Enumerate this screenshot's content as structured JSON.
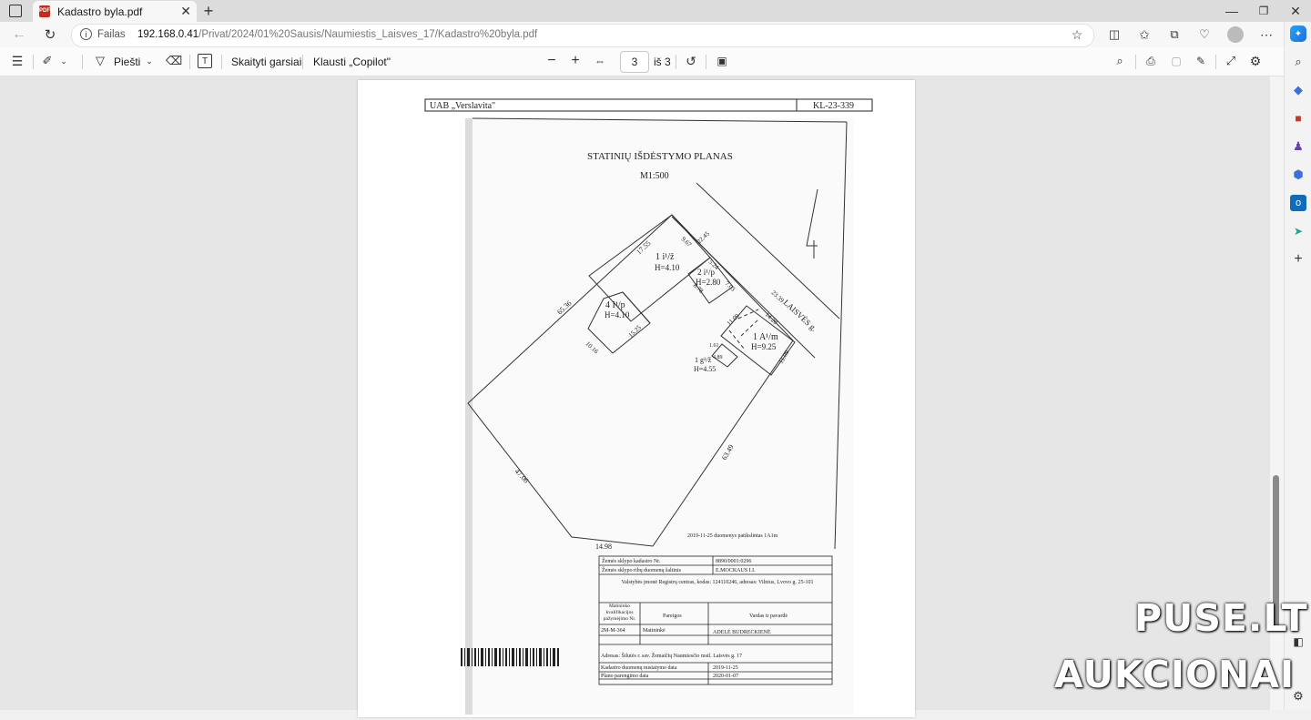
{
  "tab": {
    "title": "Kadastro byla.pdf",
    "icon": "pdf-file-icon"
  },
  "address": {
    "label": "Failas",
    "host": "192.168.0.41",
    "path": "/Privat/2024/01%20Sausis/Naumiestis_Laisves_17/Kadastro%20byla.pdf"
  },
  "pdf_toolbar": {
    "draw_label": "Piešti",
    "read_aloud_label": "Skaityti garsiai",
    "ask_copilot_label": "Klausti „Copilot\"",
    "page_number": "3",
    "page_total": "iš 3"
  },
  "document": {
    "header_company": "UAB „Verslavita\"",
    "header_code": "KL-23-339",
    "plan_title": "STATINIŲ IŠDĖSTYMO PLANAS",
    "scale": "M1:500",
    "street": "LAISVĖS g.",
    "buildings": [
      {
        "name": "1 i¹/ž",
        "height": "H=4.10"
      },
      {
        "name": "2 i¹/p",
        "height": "H=2.80"
      },
      {
        "name": "4 I¹/p",
        "height": "H=4.10"
      },
      {
        "name": "1 A¹/m",
        "height": "H=9.25"
      },
      {
        "name": "1 g¹/ž",
        "height": "H=4.55"
      }
    ],
    "dimensions": [
      "65.36",
      "17.55",
      "9.67",
      "22.45",
      "5.24",
      "23.39",
      "8.78",
      "7.03",
      "10.16",
      "15.25",
      "11.09",
      "14.28",
      "11.09",
      "1.61",
      "4.89",
      "63.49",
      "47.06",
      "14.98"
    ],
    "note": "2019-11-25 duomenys patikslintas 1A1m",
    "table": {
      "parcel_code_label": "Žemės sklypo kadastro Nr.",
      "parcel_code": "8890/0001:0296",
      "boundaries_label": "Žemės sklypo ribų duomenų šaltinis",
      "boundaries": "E.MOCKAUS I.I.",
      "registry": "Valstybės įmonė Registrų centras, kodas: 124110246, adresas: Vilnius, Lvovo g. 25-101",
      "qualification_label": "Matininko kvalifikacijos pažymėjimo Nr.",
      "position_label": "Pareigos",
      "name_label": "Vardas ir pavardė",
      "qualification_no": "2M-M-364",
      "position": "Matininkė",
      "surveyor": "ADELĖ BUDRECKIENĖ",
      "address": "Adresas: Šilutės r. sav. Žemaičių Naumiesčio mstl. Laisvės g. 17",
      "data_date_label": "Kadastro duomenų nustatymo data",
      "data_date": "2019-11-25",
      "plan_date_label": "Plano parengimo data",
      "plan_date": "2020-01-07"
    }
  },
  "watermark": {
    "line1": "PUSE.LT",
    "line2": "AUKCIONAI"
  }
}
